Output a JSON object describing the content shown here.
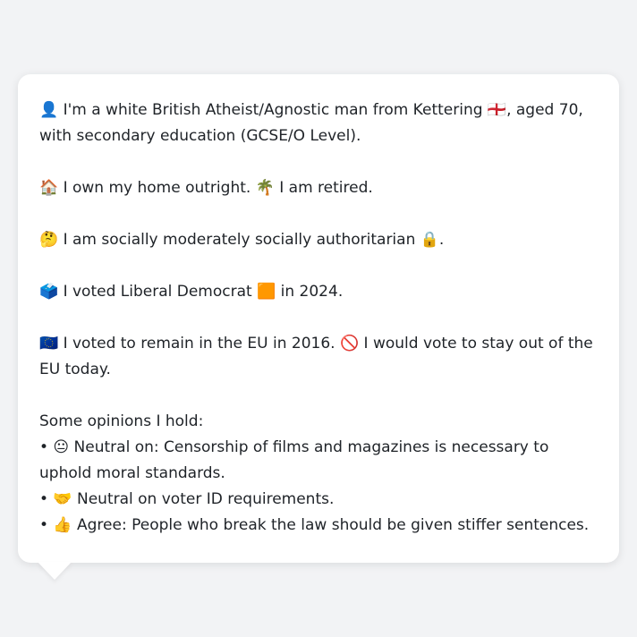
{
  "profile": {
    "line_identity": "👤 I'm a white British Atheist/Agnostic man from Kettering 🏴󠁧󠁢󠁥󠁮󠁧󠁿, aged 70, with secondary education (GCSE/O Level).",
    "line_home": "🏠 I own my home outright. 🌴 I am retired.",
    "line_social": "🤔 I am socially moderately socially authoritarian 🔒.",
    "line_vote": "🗳️ I voted Liberal Democrat 🟧 in 2024.",
    "line_eu": "🇪🇺 I voted to remain in the EU in 2016. 🚫 I would vote to stay out of the EU today.",
    "opinions_heading": "Some opinions I hold:",
    "opinions": [
      "• 😐 Neutral on: Censorship of films and magazines is necessary to uphold moral standards.",
      "• 🤝 Neutral on voter ID requirements.",
      "• 👍 Agree: People who break the law should be given stiffer sentences."
    ]
  },
  "colors": {
    "page_background": "#f2f3f5",
    "card_background": "#ffffff",
    "text": "#1f2328"
  }
}
